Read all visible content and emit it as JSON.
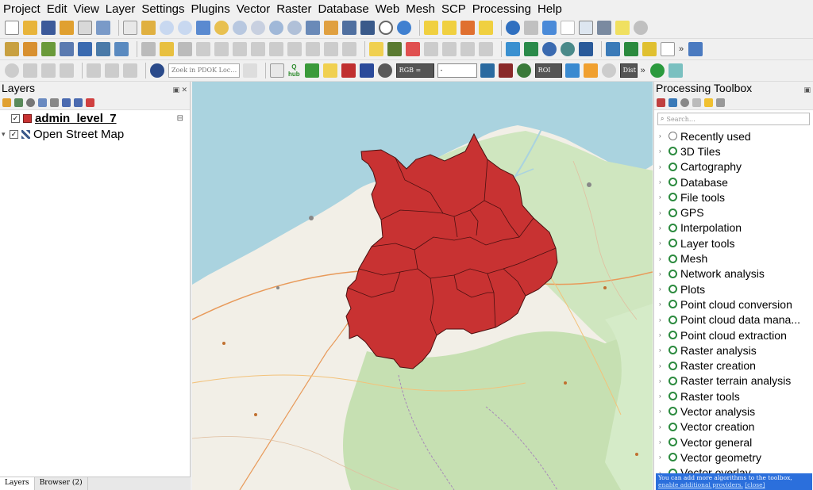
{
  "menu": [
    "Project",
    "Edit",
    "View",
    "Layer",
    "Settings",
    "Plugins",
    "Vector",
    "Raster",
    "Database",
    "Web",
    "Mesh",
    "SCP",
    "Processing",
    "Help"
  ],
  "toolbar": {
    "locator_placeholder": "Zoek in PDOK Loc…",
    "hub_label": "hub",
    "rgb_label": "RGB =",
    "band_value": "-",
    "roi_label": "ROI",
    "dist_label": "Dist",
    "overflow": "»"
  },
  "layers_panel": {
    "title": "Layers",
    "layers": [
      {
        "name": "admin_level_7",
        "checked": true,
        "type": "polygon",
        "color": "#c83232"
      },
      {
        "name": "Open Street Map",
        "checked": true,
        "type": "raster"
      }
    ],
    "tabs": [
      "Layers",
      "Browser (2)"
    ]
  },
  "toolbox": {
    "title": "Processing Toolbox",
    "search_placeholder": "Search…",
    "items": [
      "Recently used",
      "3D Tiles",
      "Cartography",
      "Database",
      "File tools",
      "GPS",
      "Interpolation",
      "Layer tools",
      "Mesh",
      "Network analysis",
      "Plots",
      "Point cloud conversion",
      "Point cloud data mana...",
      "Point cloud extraction",
      "Raster analysis",
      "Raster creation",
      "Raster terrain analysis",
      "Raster tools",
      "Vector analysis",
      "Vector creation",
      "Vector general",
      "Vector geometry",
      "Vector overlay"
    ],
    "tip_text": "You can add more algorithms to the toolbox,",
    "tip_link": "enable additional providers.",
    "tip_close": "[close]"
  },
  "colors": {
    "polygon_fill": "#c83232",
    "sea": "#aad3df",
    "land": "#f2efe7",
    "qgis_green": "#2b8a3e"
  }
}
